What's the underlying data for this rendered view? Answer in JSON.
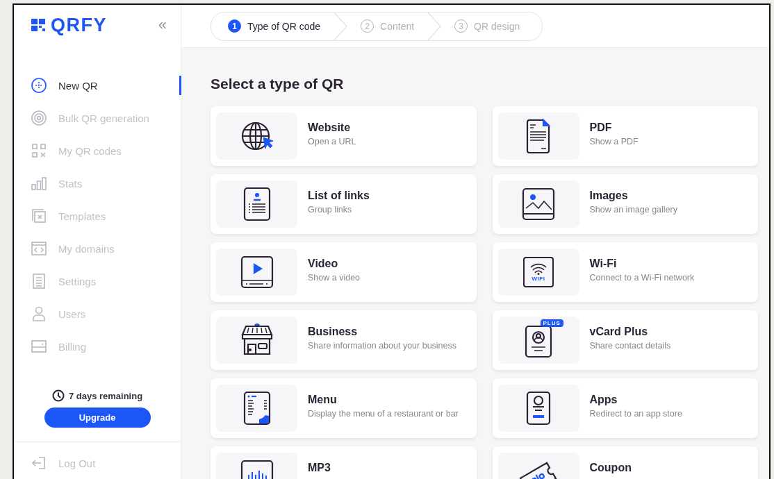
{
  "sidebar": {
    "logo": "QRFY",
    "collapse": "«",
    "items": [
      {
        "kind": "new",
        "label": "New QR",
        "selected": true
      },
      {
        "kind": "bulk",
        "label": "Bulk QR generation",
        "selected": false
      },
      {
        "kind": "codes",
        "label": "My QR codes",
        "selected": false
      },
      {
        "kind": "stats",
        "label": "Stats",
        "selected": false
      },
      {
        "kind": "templates",
        "label": "Templates",
        "selected": false
      },
      {
        "kind": "domains",
        "label": "My domains",
        "selected": false
      },
      {
        "kind": "settings",
        "label": "Settings",
        "selected": false
      },
      {
        "kind": "users",
        "label": "Users",
        "selected": false
      },
      {
        "kind": "billing",
        "label": "Billing",
        "selected": false
      }
    ],
    "trial": "7 days remaining",
    "upgrade": "Upgrade",
    "logout": "Log Out"
  },
  "steps": [
    {
      "number": "1",
      "label": "Type of QR code",
      "selected": true
    },
    {
      "number": "2",
      "label": "Content",
      "selected": false
    },
    {
      "number": "3",
      "label": "QR design",
      "selected": false
    }
  ],
  "heading": "Select a type of QR",
  "qr_types": [
    {
      "kind": "website",
      "title": "Website",
      "subtitle": "Open a URL"
    },
    {
      "kind": "pdf",
      "title": "PDF",
      "subtitle": "Show a PDF"
    },
    {
      "kind": "links",
      "title": "List of links",
      "subtitle": "Group links"
    },
    {
      "kind": "images",
      "title": "Images",
      "subtitle": "Show an image gallery"
    },
    {
      "kind": "video",
      "title": "Video",
      "subtitle": "Show a video"
    },
    {
      "kind": "wifi",
      "title": "Wi-Fi",
      "subtitle": "Connect to a Wi-Fi network",
      "icon_text": "WIFI"
    },
    {
      "kind": "business",
      "title": "Business",
      "subtitle": "Share information about your business"
    },
    {
      "kind": "vcard",
      "title": "vCard Plus",
      "subtitle": "Share contact details",
      "badge": "PLUS"
    },
    {
      "kind": "menu",
      "title": "Menu",
      "subtitle": "Display the menu of a restaurant or bar"
    },
    {
      "kind": "apps",
      "title": "Apps",
      "subtitle": "Redirect to an app store"
    },
    {
      "kind": "mp3",
      "title": "MP3"
    },
    {
      "kind": "coupon",
      "title": "Coupon"
    }
  ]
}
